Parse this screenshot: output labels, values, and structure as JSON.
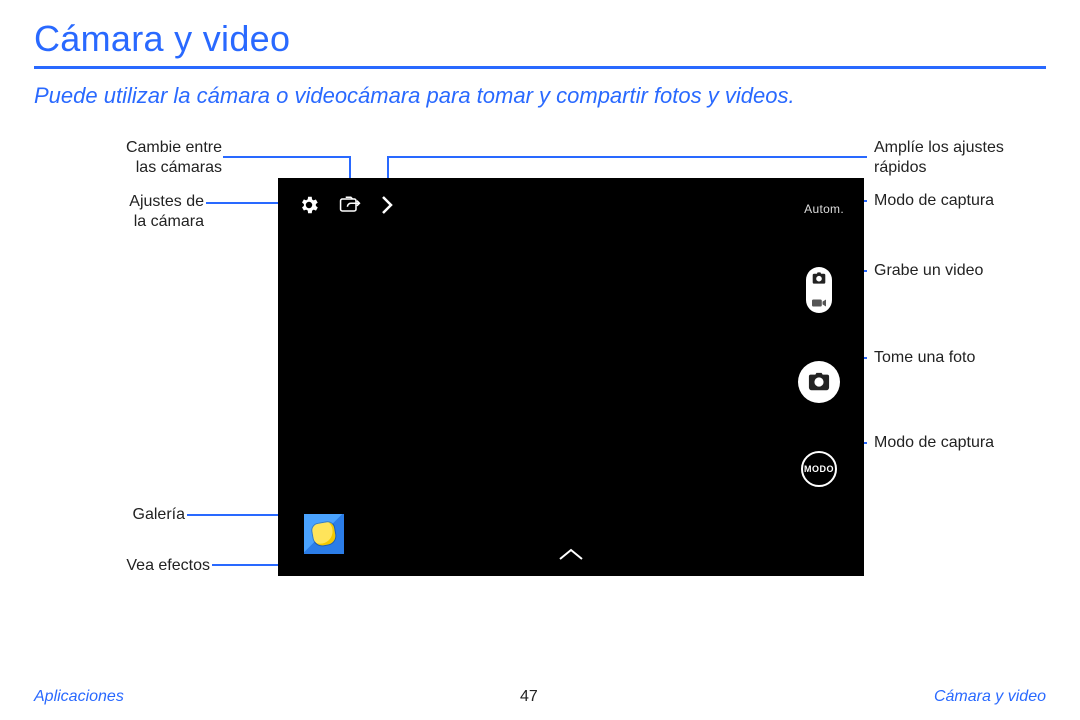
{
  "title": "Cámara y video",
  "lede": "Puede utilizar la cámara o videocámara para tomar y compartir fotos y videos.",
  "camera": {
    "autoLabel": "Autom.",
    "modoLabel": "MODO"
  },
  "callouts": {
    "switch": "Cambie entre\nlas cámaras",
    "settings": "Ajustes de\nla cámara",
    "gallery": "Galería",
    "effects": "Vea efectos",
    "expand": "Amplíe los ajustes\nrápidos",
    "mode1": "Modo de captura",
    "record": "Grabe un video",
    "shutter": "Tome una foto",
    "mode2": "Modo de captura"
  },
  "footer": {
    "section": "Aplicaciones",
    "page": "47",
    "subsection": "Cámara y video"
  }
}
